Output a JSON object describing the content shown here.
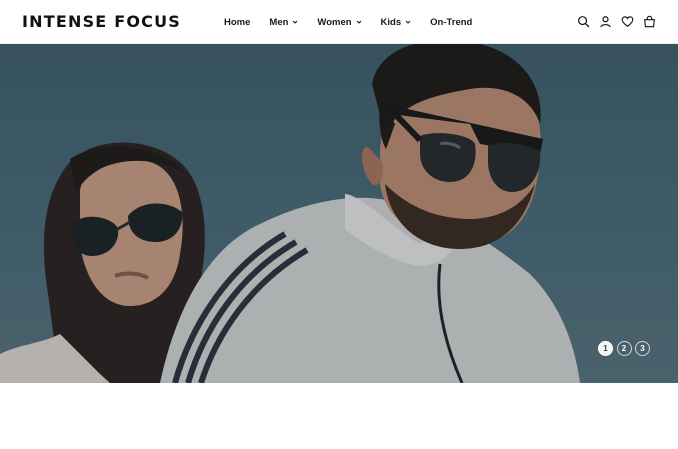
{
  "brand": {
    "logo": "INTENSE FOCUS"
  },
  "nav": {
    "items": [
      {
        "label": "Home",
        "dropdown": false
      },
      {
        "label": "Men",
        "dropdown": true
      },
      {
        "label": "Women",
        "dropdown": true
      },
      {
        "label": "Kids",
        "dropdown": true
      },
      {
        "label": "On-Trend",
        "dropdown": false
      }
    ]
  },
  "header_icons": [
    "search-icon",
    "account-icon",
    "wishlist-heart-icon",
    "cart-bag-icon"
  ],
  "hero": {
    "image": "photo of a man in white track jacket and dark sunglasses with a woman in aviator sunglasses against a blue sky",
    "slides": [
      "1",
      "2",
      "3"
    ],
    "active_slide": "1"
  },
  "colors": {
    "accent": "#111111",
    "background": "#ffffff",
    "hero_sky": "#486a78"
  }
}
